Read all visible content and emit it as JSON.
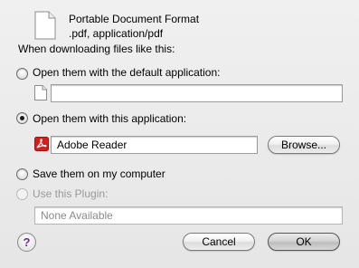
{
  "file_type": {
    "name": "Portable Document Format",
    "extension_mime": ".pdf, application/pdf"
  },
  "prompt": "When downloading files like this:",
  "options": {
    "default_app": {
      "label": "Open them with the default application:",
      "selected": false,
      "field_value": ""
    },
    "this_app": {
      "label": "Open them with this application:",
      "selected": true,
      "field_value": "Adobe Reader",
      "browse_label": "Browse..."
    },
    "save": {
      "label": "Save them on my computer",
      "selected": false
    },
    "plugin": {
      "label": "Use this Plugin:",
      "selected": false,
      "disabled": true,
      "field_value": "None Available"
    }
  },
  "buttons": {
    "help": "?",
    "cancel": "Cancel",
    "ok": "OK"
  }
}
